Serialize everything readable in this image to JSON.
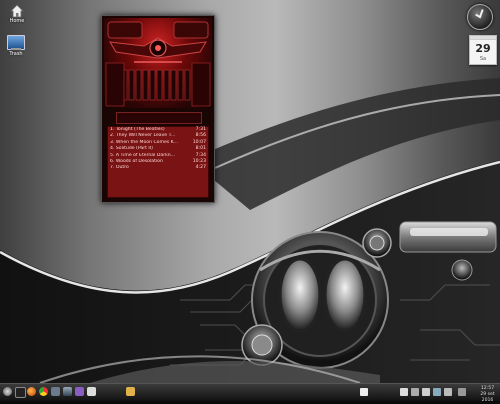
{
  "desktop": {
    "icons": [
      {
        "label": "Home",
        "icon": "home-folder-icon"
      },
      {
        "label": "Trash",
        "icon": "computer-icon"
      }
    ]
  },
  "widgets": {
    "calendar": {
      "day": "29",
      "month": "Sa"
    }
  },
  "player": {
    "playlist": [
      {
        "n": "1.",
        "title": "Tonight (The Beatles)",
        "dur": "7:31"
      },
      {
        "n": "2.",
        "title": "They Will Never Leave T...",
        "dur": "8:56"
      },
      {
        "n": "3.",
        "title": "When the Moon Comes K...",
        "dur": "10:07"
      },
      {
        "n": "4.",
        "title": "Solitude (Part II)",
        "dur": "8:01"
      },
      {
        "n": "5.",
        "title": "A Time of Eternal Darkn...",
        "dur": "7:34"
      },
      {
        "n": "6.",
        "title": "Woods of Desolation",
        "dur": "10:23"
      },
      {
        "n": "7.",
        "title": "Outro",
        "dur": "4:27"
      }
    ]
  },
  "taskbar": {
    "launchers": [
      "menu-icon",
      "terminal-icon",
      "firefox-icon",
      "chrome-icon",
      "settings-icon",
      "monitor-icon",
      "media-icon",
      "video-icon"
    ],
    "task_icon": "folder-icon",
    "tray": [
      "window-icon",
      "network-icon",
      "volume-icon",
      "battery-icon",
      "display-icon",
      "user-icon",
      "update-icon"
    ],
    "clock": {
      "time": "12:57",
      "date": "29 set 2016"
    }
  },
  "colors": {
    "accent": "#8a1111",
    "playlist_bg": "#7a1414",
    "chrome": "#b5b5b5"
  }
}
